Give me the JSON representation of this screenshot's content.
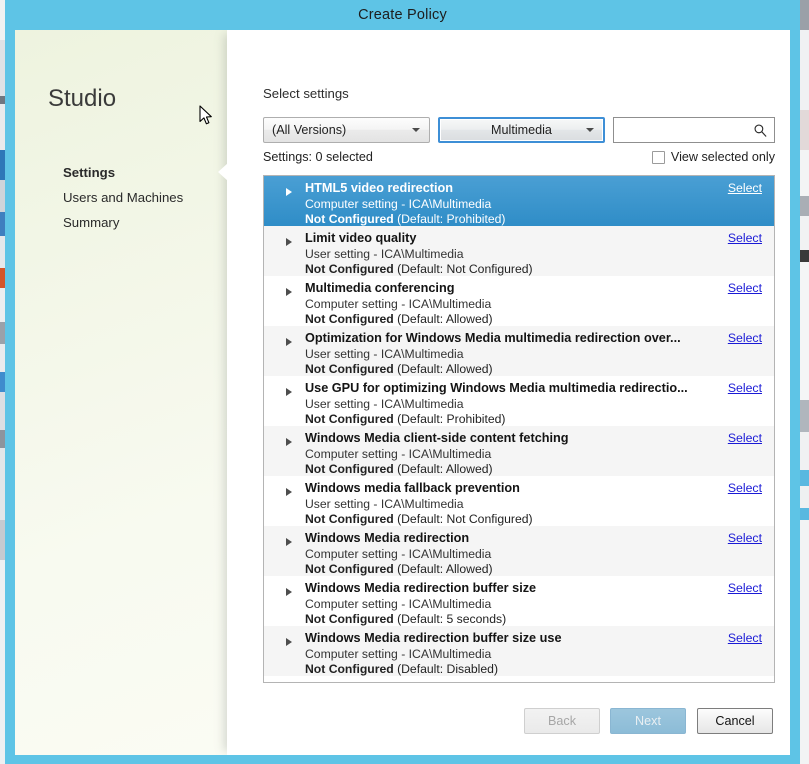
{
  "window": {
    "title": "Create Policy"
  },
  "nav": {
    "brand": "Studio",
    "steps": [
      {
        "label": "Settings",
        "active": true
      },
      {
        "label": "Users and Machines",
        "active": false
      },
      {
        "label": "Summary",
        "active": false
      }
    ]
  },
  "main": {
    "heading": "Select settings",
    "version_filter": "(All Versions)",
    "category_filter": "Multimedia",
    "search_value": "",
    "search_placeholder": "",
    "search_icon": "search-icon",
    "settings_count_label": "Settings: 0 selected",
    "view_selected_only_label": "View selected only",
    "view_selected_only_checked": false,
    "select_link_label": "Select"
  },
  "settings": [
    {
      "title": "HTML5 video redirection",
      "scope": "Computer setting - ICA\\Multimedia",
      "state_bold": "Not Configured",
      "state_rest": " (Default: Prohibited)",
      "selected": true
    },
    {
      "title": "Limit video quality",
      "scope": "User setting - ICA\\Multimedia",
      "state_bold": "Not Configured",
      "state_rest": " (Default: Not Configured)",
      "selected": false
    },
    {
      "title": "Multimedia conferencing",
      "scope": "Computer setting - ICA\\Multimedia",
      "state_bold": "Not Configured",
      "state_rest": " (Default: Allowed)",
      "selected": false
    },
    {
      "title": "Optimization for Windows Media multimedia redirection over...",
      "scope": "User setting - ICA\\Multimedia",
      "state_bold": "Not Configured",
      "state_rest": " (Default: Allowed)",
      "selected": false
    },
    {
      "title": "Use GPU for optimizing Windows Media multimedia redirectio...",
      "scope": "User setting - ICA\\Multimedia",
      "state_bold": "Not Configured",
      "state_rest": " (Default: Prohibited)",
      "selected": false
    },
    {
      "title": "Windows Media client-side content fetching",
      "scope": "Computer setting - ICA\\Multimedia",
      "state_bold": "Not Configured",
      "state_rest": " (Default: Allowed)",
      "selected": false
    },
    {
      "title": "Windows media fallback prevention",
      "scope": "User setting - ICA\\Multimedia",
      "state_bold": "Not Configured",
      "state_rest": " (Default: Not Configured)",
      "selected": false
    },
    {
      "title": "Windows Media redirection",
      "scope": "Computer setting - ICA\\Multimedia",
      "state_bold": "Not Configured",
      "state_rest": " (Default: Allowed)",
      "selected": false
    },
    {
      "title": "Windows Media redirection buffer size",
      "scope": "Computer setting - ICA\\Multimedia",
      "state_bold": "Not Configured",
      "state_rest": " (Default: 5  seconds)",
      "selected": false
    },
    {
      "title": "Windows Media redirection buffer size use",
      "scope": "Computer setting - ICA\\Multimedia",
      "state_bold": "Not Configured",
      "state_rest": " (Default: Disabled)",
      "selected": false
    }
  ],
  "footer": {
    "back_label": "Back",
    "next_label": "Next",
    "cancel_label": "Cancel"
  },
  "colors": {
    "title_bar": "#5ec4e6",
    "accent_selection": "#2f8dc7",
    "focus_border": "#3e8fd6",
    "link": "#1a1ad6"
  }
}
